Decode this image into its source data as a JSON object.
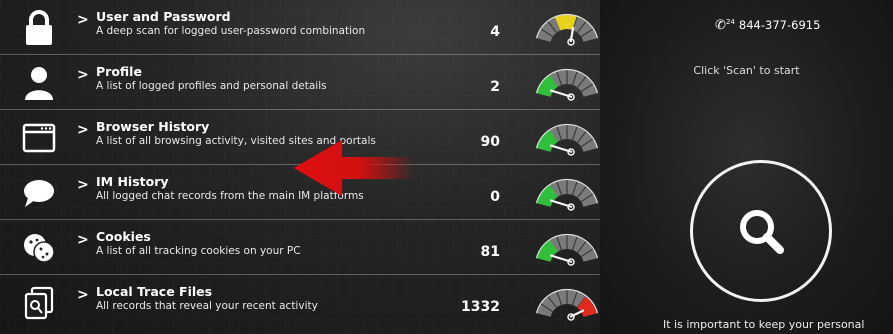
{
  "items": [
    {
      "title": "User and Password",
      "desc": "A deep scan for logged user-password combination",
      "count": "4",
      "icon": "lock-icon",
      "level": "yellow",
      "needle": 0.62
    },
    {
      "title": "Profile",
      "desc": "A list of logged profiles and personal details",
      "count": "2",
      "icon": "user-icon",
      "level": "green",
      "needle": 0.12
    },
    {
      "title": "Browser History",
      "desc": "A list of all browsing activity, visited sites and portals",
      "count": "90",
      "icon": "browser-window-icon",
      "level": "green",
      "needle": 0.12
    },
    {
      "title": "IM History",
      "desc": "All logged chat records from the main IM platforms",
      "count": "0",
      "icon": "chat-bubble-icon",
      "level": "green",
      "needle": 0.12
    },
    {
      "title": "Cookies",
      "desc": "A list of all tracking cookies on your PC",
      "count": "81",
      "icon": "cookie-icon",
      "level": "green",
      "needle": 0.12
    },
    {
      "title": "Local Trace Files",
      "desc": "All records that reveal your recent activity",
      "count": "1332",
      "icon": "files-icon",
      "level": "red",
      "needle": 0.88
    }
  ],
  "phone": {
    "label": "844-377-6915",
    "badge": "24"
  },
  "hint": "Click 'Scan' to start",
  "footer": "It is important to keep your personal",
  "colors": {
    "green": "#2fbf3a",
    "yellow": "#e8d21d",
    "red": "#e02a20",
    "gauge_base": "#7a7a7a"
  }
}
